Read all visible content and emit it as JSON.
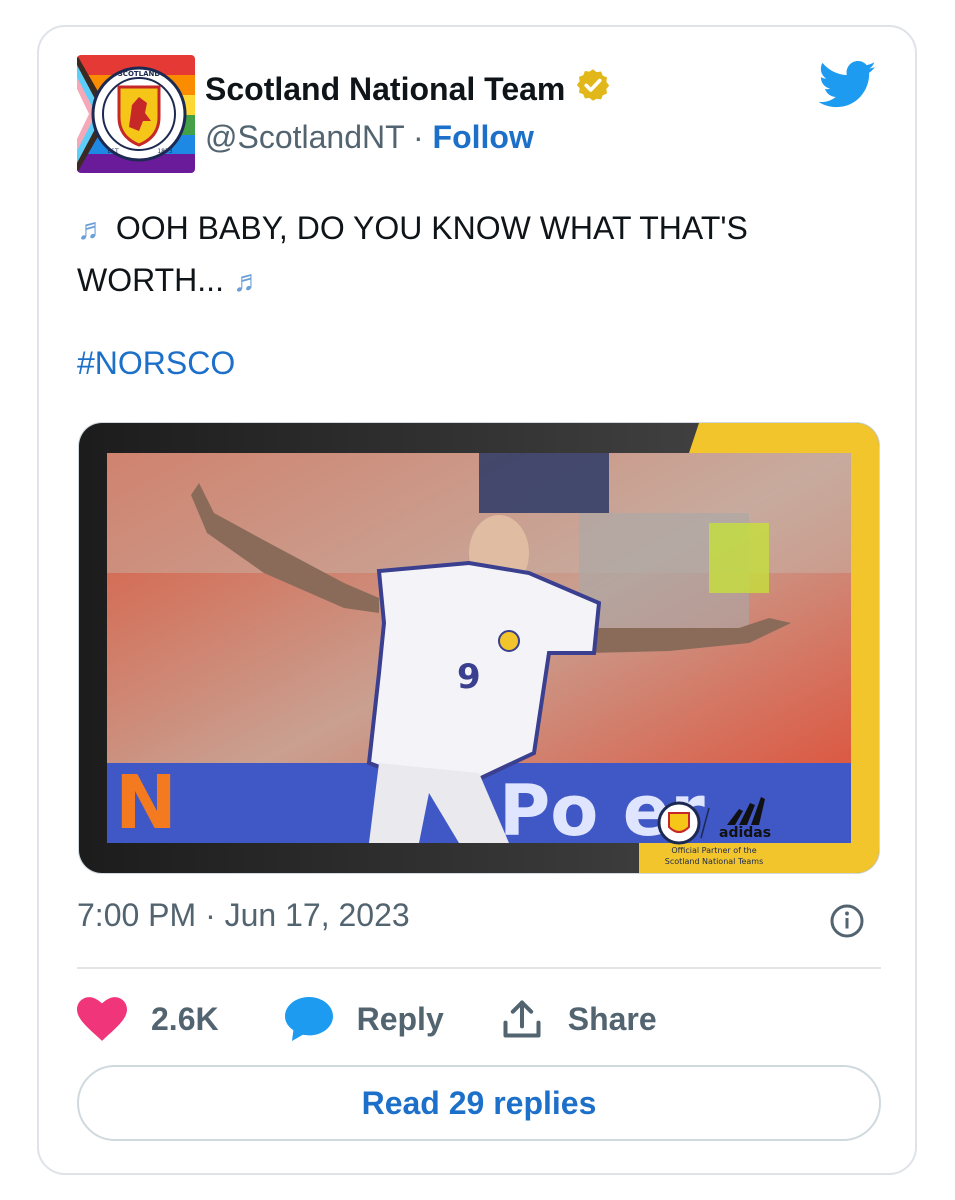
{
  "author": {
    "name": "Scotland National Team",
    "handle": "@ScotlandNT",
    "separator": "·",
    "follow_label": "Follow",
    "verified": true,
    "avatar_badge_text_top": "SCOTLAND",
    "avatar_badge_text_left": "EST",
    "avatar_badge_text_right": "1873"
  },
  "tweet": {
    "text_line1": "OOH BABY, DO YOU KNOW WHAT THAT'S",
    "text_line2": "WORTH...",
    "note_icon": "music-notes-icon",
    "hashtag": "#NORSCO"
  },
  "media": {
    "player_number": "9",
    "billboard_left": "N",
    "billboard_right": "Po  er",
    "sponsor_logo": "adidas",
    "sponsor_line1": "Official Partner of the",
    "sponsor_line2": "Scotland National Teams"
  },
  "timestamp": "7:00 PM · Jun 17, 2023",
  "actions": {
    "likes": "2.6K",
    "reply_label": "Reply",
    "share_label": "Share"
  },
  "read_replies_label": "Read 29 replies",
  "colors": {
    "link": "#1d70c9",
    "heart": "#f0357a",
    "reply": "#1d9bf0",
    "twitter_bird": "#1d9bf0",
    "verified_badge": "#e2b719",
    "media_yellow": "#f2c52d"
  }
}
